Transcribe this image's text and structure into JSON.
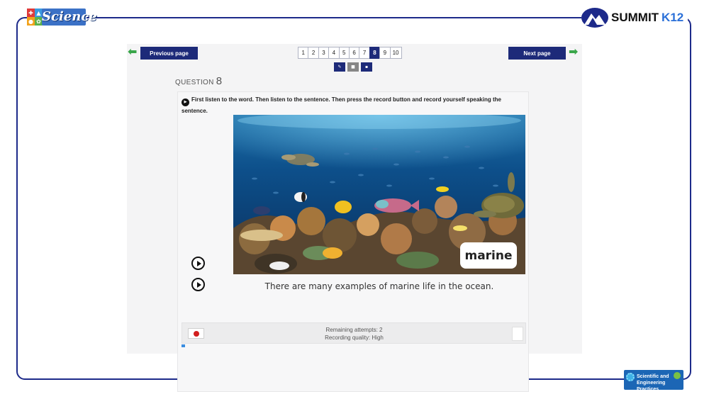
{
  "branding": {
    "science_logo_text": "Science",
    "summit_name": "SUMMIT",
    "summit_k12": "K12",
    "practices_badge": "Scientific and Engineering Practices",
    "colors": {
      "frame": "#1d2a8a",
      "nav": "#1d2a79",
      "arrow": "#3aa64a",
      "record": "#d21e1e"
    }
  },
  "nav": {
    "prev_label": "Previous page",
    "next_label": "Next page",
    "prev_arrow_icon": "arrow-left-icon",
    "next_arrow_icon": "arrow-right-icon",
    "pages": [
      "1",
      "2",
      "3",
      "4",
      "5",
      "6",
      "7",
      "8",
      "9",
      "10"
    ],
    "current_page": "8"
  },
  "tools": [
    {
      "name": "pencil-icon",
      "glyph": "✎"
    },
    {
      "name": "bookmark-icon",
      "glyph": "■"
    },
    {
      "name": "note-icon",
      "glyph": "▪"
    }
  ],
  "question": {
    "label": "QUESTION",
    "number": "8",
    "instruction": "First listen to the word. Then listen to the sentence. Then press the record button and record yourself speaking the sentence.",
    "word": "marine",
    "sentence": "There are many examples of marine life in the ocean."
  },
  "recording": {
    "attempts_text": "Remaining attempts: 2",
    "quality_text": "Recording quality: High",
    "progress": 0.01
  }
}
